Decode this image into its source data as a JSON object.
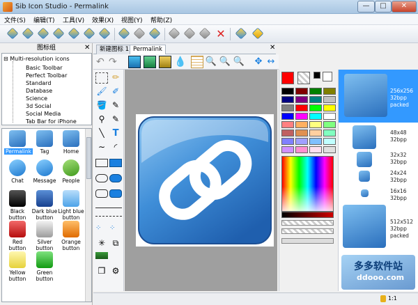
{
  "window": {
    "title": "Sib Icon Studio - Permalink",
    "min_glyph": "—",
    "max_glyph": "□",
    "close_glyph": "✕"
  },
  "menu": [
    "文件(S)",
    "编辑(T)",
    "工具(V)",
    "效果(X)",
    "视图(Y)",
    "帮助(Z)"
  ],
  "left_panel": {
    "title": "图标组",
    "close_glyph": "✕",
    "tree_root": "Multi-resolution icons",
    "tree_items": [
      "Basic Toolbar",
      "Perfect Toolbar",
      "Standard",
      "Database",
      "Science",
      "3d Social",
      "Social Media",
      "Tab Bar for iPhone"
    ],
    "icons": [
      {
        "label": "Permalink",
        "selected": true
      },
      {
        "label": "Tag"
      },
      {
        "label": "Home"
      },
      {
        "label": "Chat"
      },
      {
        "label": "Message"
      },
      {
        "label": "People"
      },
      {
        "label": "Black button"
      },
      {
        "label": "Dark blue button"
      },
      {
        "label": "Light blue button"
      },
      {
        "label": "Red button"
      },
      {
        "label": "Silver button"
      },
      {
        "label": "Orange button"
      },
      {
        "label": "Yellow button"
      },
      {
        "label": "Green button"
      }
    ]
  },
  "document": {
    "tabs": [
      "新建图标 1",
      "Permalink"
    ],
    "active_tab": "Permalink",
    "close_glyph": "✕"
  },
  "previews": [
    {
      "size": "256x256",
      "depth": "32bpp",
      "format": "packed",
      "selected": true
    },
    {
      "size": "48x48",
      "depth": "32bpp"
    },
    {
      "size": "32x32",
      "depth": "32bpp"
    },
    {
      "size": "24x24",
      "depth": "32bpp"
    },
    {
      "size": "16x16",
      "depth": "32bpp"
    },
    {
      "size": "512x512",
      "depth": "32bpp",
      "format": "packed"
    }
  ],
  "statusbar": {
    "zoom": "1:1"
  },
  "watermark": {
    "brand": "多多软件站",
    "domain": "ddooo.com"
  },
  "colors": {
    "accent": "#3399ff",
    "icon_blue": "#2a6fbd",
    "selection_text": "#ffffff"
  }
}
